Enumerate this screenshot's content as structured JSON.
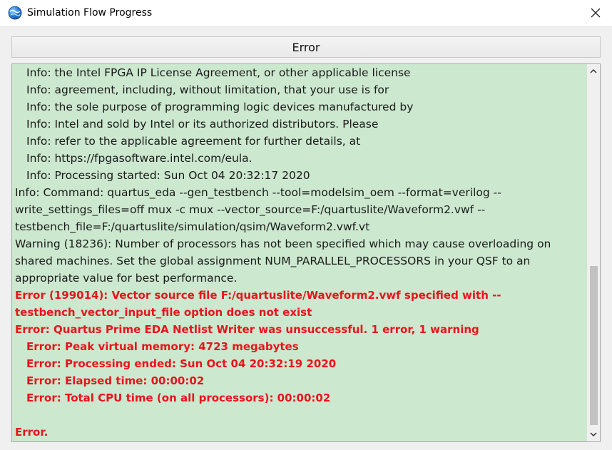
{
  "window": {
    "title": "Simulation Flow Progress"
  },
  "status": {
    "label": "Error"
  },
  "log": {
    "lines": [
      {
        "text": "Info: the Intel FPGA IP License Agreement, or other applicable license",
        "kind": "info",
        "indent": true
      },
      {
        "text": "Info: agreement, including, without limitation, that your use is for",
        "kind": "info",
        "indent": true
      },
      {
        "text": "Info: the sole purpose of programming logic devices manufactured by",
        "kind": "info",
        "indent": true
      },
      {
        "text": "Info: Intel and sold by Intel or its authorized distributors.  Please",
        "kind": "info",
        "indent": true
      },
      {
        "text": "Info: refer to the applicable agreement for further details, at",
        "kind": "info",
        "indent": true
      },
      {
        "text": "Info: https://fpgasoftware.intel.com/eula.",
        "kind": "info",
        "indent": true
      },
      {
        "text": "Info: Processing started: Sun Oct 04 20:32:17 2020",
        "kind": "info",
        "indent": true
      },
      {
        "text": "Info: Command: quartus_eda --gen_testbench --tool=modelsim_oem --format=verilog --",
        "kind": "info",
        "indent": false
      },
      {
        "text": "write_settings_files=off mux -c mux --vector_source=F:/quartuslite/Waveform2.vwf --",
        "kind": "info",
        "indent": false
      },
      {
        "text": "testbench_file=F:/quartuslite/simulation/qsim/Waveform2.vwf.vt",
        "kind": "info",
        "indent": false
      },
      {
        "text": "Warning (18236): Number of processors has not been specified which may cause overloading on",
        "kind": "info",
        "indent": false
      },
      {
        "text": "shared machines.  Set the global assignment NUM_PARALLEL_PROCESSORS in your QSF to an",
        "kind": "info",
        "indent": false
      },
      {
        "text": "appropriate value for best performance.",
        "kind": "info",
        "indent": false
      },
      {
        "text": "Error (199014): Vector source file F:/quartuslite/Waveform2.vwf specified with --",
        "kind": "error",
        "indent": false
      },
      {
        "text": "testbench_vector_input_file option does not exist",
        "kind": "error",
        "indent": false
      },
      {
        "text": "Error: Quartus Prime EDA Netlist Writer was unsuccessful. 1 error, 1 warning",
        "kind": "error",
        "indent": false
      },
      {
        "text": "Error: Peak virtual memory: 4723 megabytes",
        "kind": "error",
        "indent": true
      },
      {
        "text": "Error: Processing ended: Sun Oct 04 20:32:19 2020",
        "kind": "error",
        "indent": true
      },
      {
        "text": "Error: Elapsed time: 00:00:02",
        "kind": "error",
        "indent": true
      },
      {
        "text": "Error: Total CPU time (on all processors): 00:00:02",
        "kind": "error",
        "indent": true
      },
      {
        "text": "",
        "kind": "blank",
        "indent": false
      },
      {
        "text": "Error.",
        "kind": "error",
        "indent": false
      }
    ]
  },
  "colors": {
    "log_background": "#cce8cf",
    "error_text": "#e8141c",
    "info_text": "#1a1a1a"
  },
  "icons": {
    "app": "globe-app-icon",
    "close": "close-icon",
    "scroll_up": "chevron-up-icon",
    "scroll_down": "chevron-down-icon"
  }
}
